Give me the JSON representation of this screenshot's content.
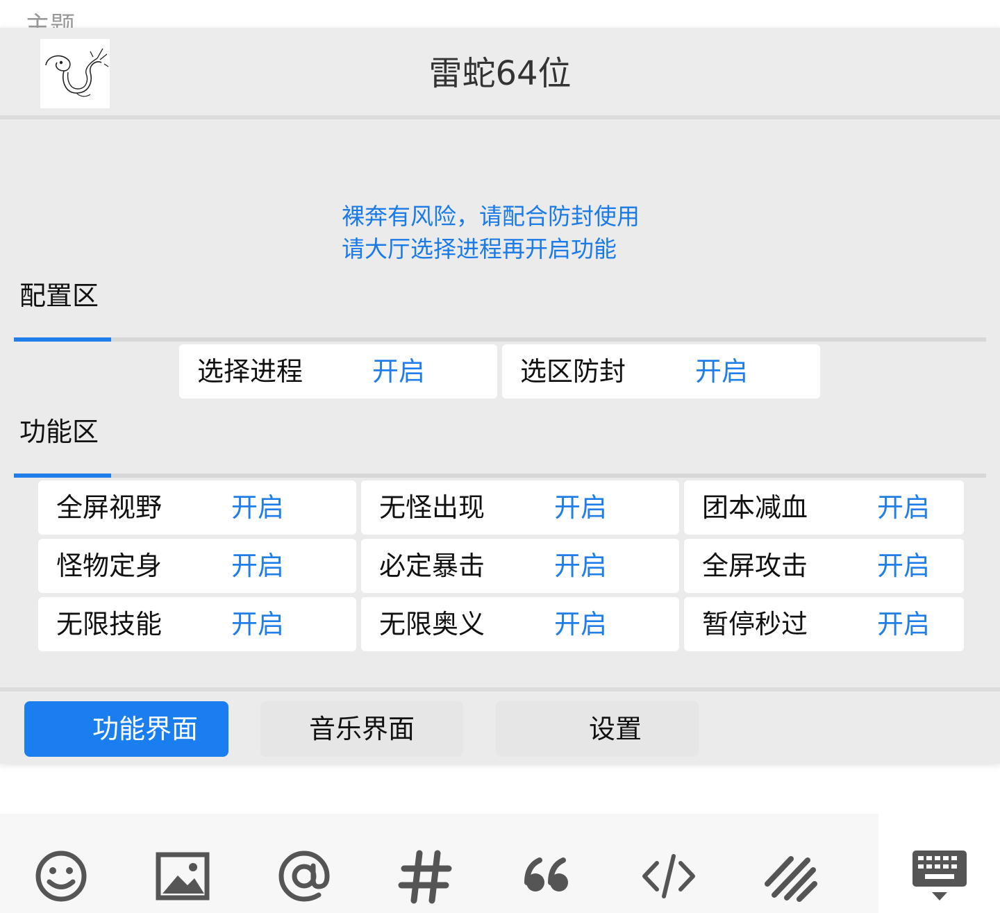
{
  "background": {
    "cut_text": "主题"
  },
  "header": {
    "title": "雷蛇64位"
  },
  "notice": {
    "line1": "裸奔有风险，请配合防封使用",
    "line2": "请大厅选择进程再开启功能"
  },
  "config": {
    "title": "配置区",
    "items": [
      {
        "label": "选择进程",
        "state": "开启"
      },
      {
        "label": "选区防封",
        "state": "开启"
      }
    ]
  },
  "features": {
    "title": "功能区",
    "items": [
      {
        "label": "全屏视野",
        "state": "开启"
      },
      {
        "label": "无怪出现",
        "state": "开启"
      },
      {
        "label": "团本减血",
        "state": "开启"
      },
      {
        "label": "怪物定身",
        "state": "开启"
      },
      {
        "label": "必定暴击",
        "state": "开启"
      },
      {
        "label": "全屏攻击",
        "state": "开启"
      },
      {
        "label": "无限技能",
        "state": "开启"
      },
      {
        "label": "无限奥义",
        "state": "开启"
      },
      {
        "label": "暂停秒过",
        "state": "开启"
      }
    ]
  },
  "tabs": [
    {
      "label": "功能界面",
      "active": true
    },
    {
      "label": "音乐界面",
      "active": false
    },
    {
      "label": "设置",
      "active": false
    }
  ],
  "toolbar": {
    "icons": [
      "emoji-icon",
      "image-icon",
      "mention-icon",
      "hashtag-icon",
      "quote-icon",
      "code-icon",
      "divider-icon",
      "keyboard-icon"
    ]
  },
  "colors": {
    "accent": "#1f7ee8",
    "active_tab": "#1b7ef0",
    "panel_bg": "#ebebeb",
    "notice_text": "#1a7ae6",
    "icon_gray": "#555555"
  }
}
